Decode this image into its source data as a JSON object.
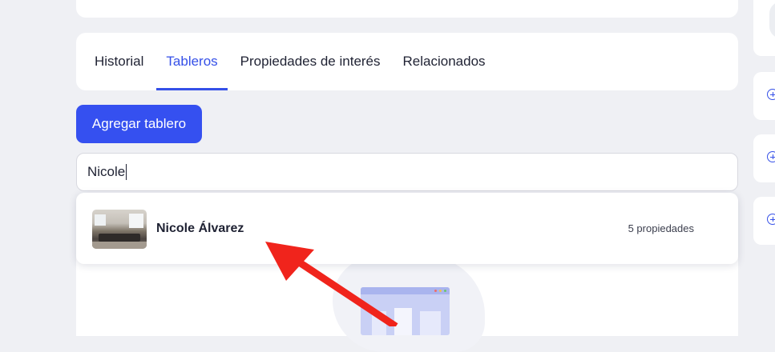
{
  "tabs": [
    {
      "label": "Historial",
      "active": false
    },
    {
      "label": "Tableros",
      "active": true
    },
    {
      "label": "Propiedades de interés",
      "active": false
    },
    {
      "label": "Relacionados",
      "active": false
    }
  ],
  "actions": {
    "add_board_label": "Agregar tablero"
  },
  "search": {
    "value": "Nicole"
  },
  "results": [
    {
      "name": "Nicole Álvarez",
      "count": "5 propiedades",
      "thumbnail": "living-room-photo"
    }
  ],
  "side_actions": [
    {
      "icon": "plus-circle-icon"
    },
    {
      "icon": "plus-circle-icon"
    },
    {
      "icon": "plus-circle-icon"
    }
  ],
  "colors": {
    "accent": "#3550e8",
    "button": "#3550f0",
    "annotation_arrow": "#f0241c",
    "background": "#eff0f4"
  }
}
